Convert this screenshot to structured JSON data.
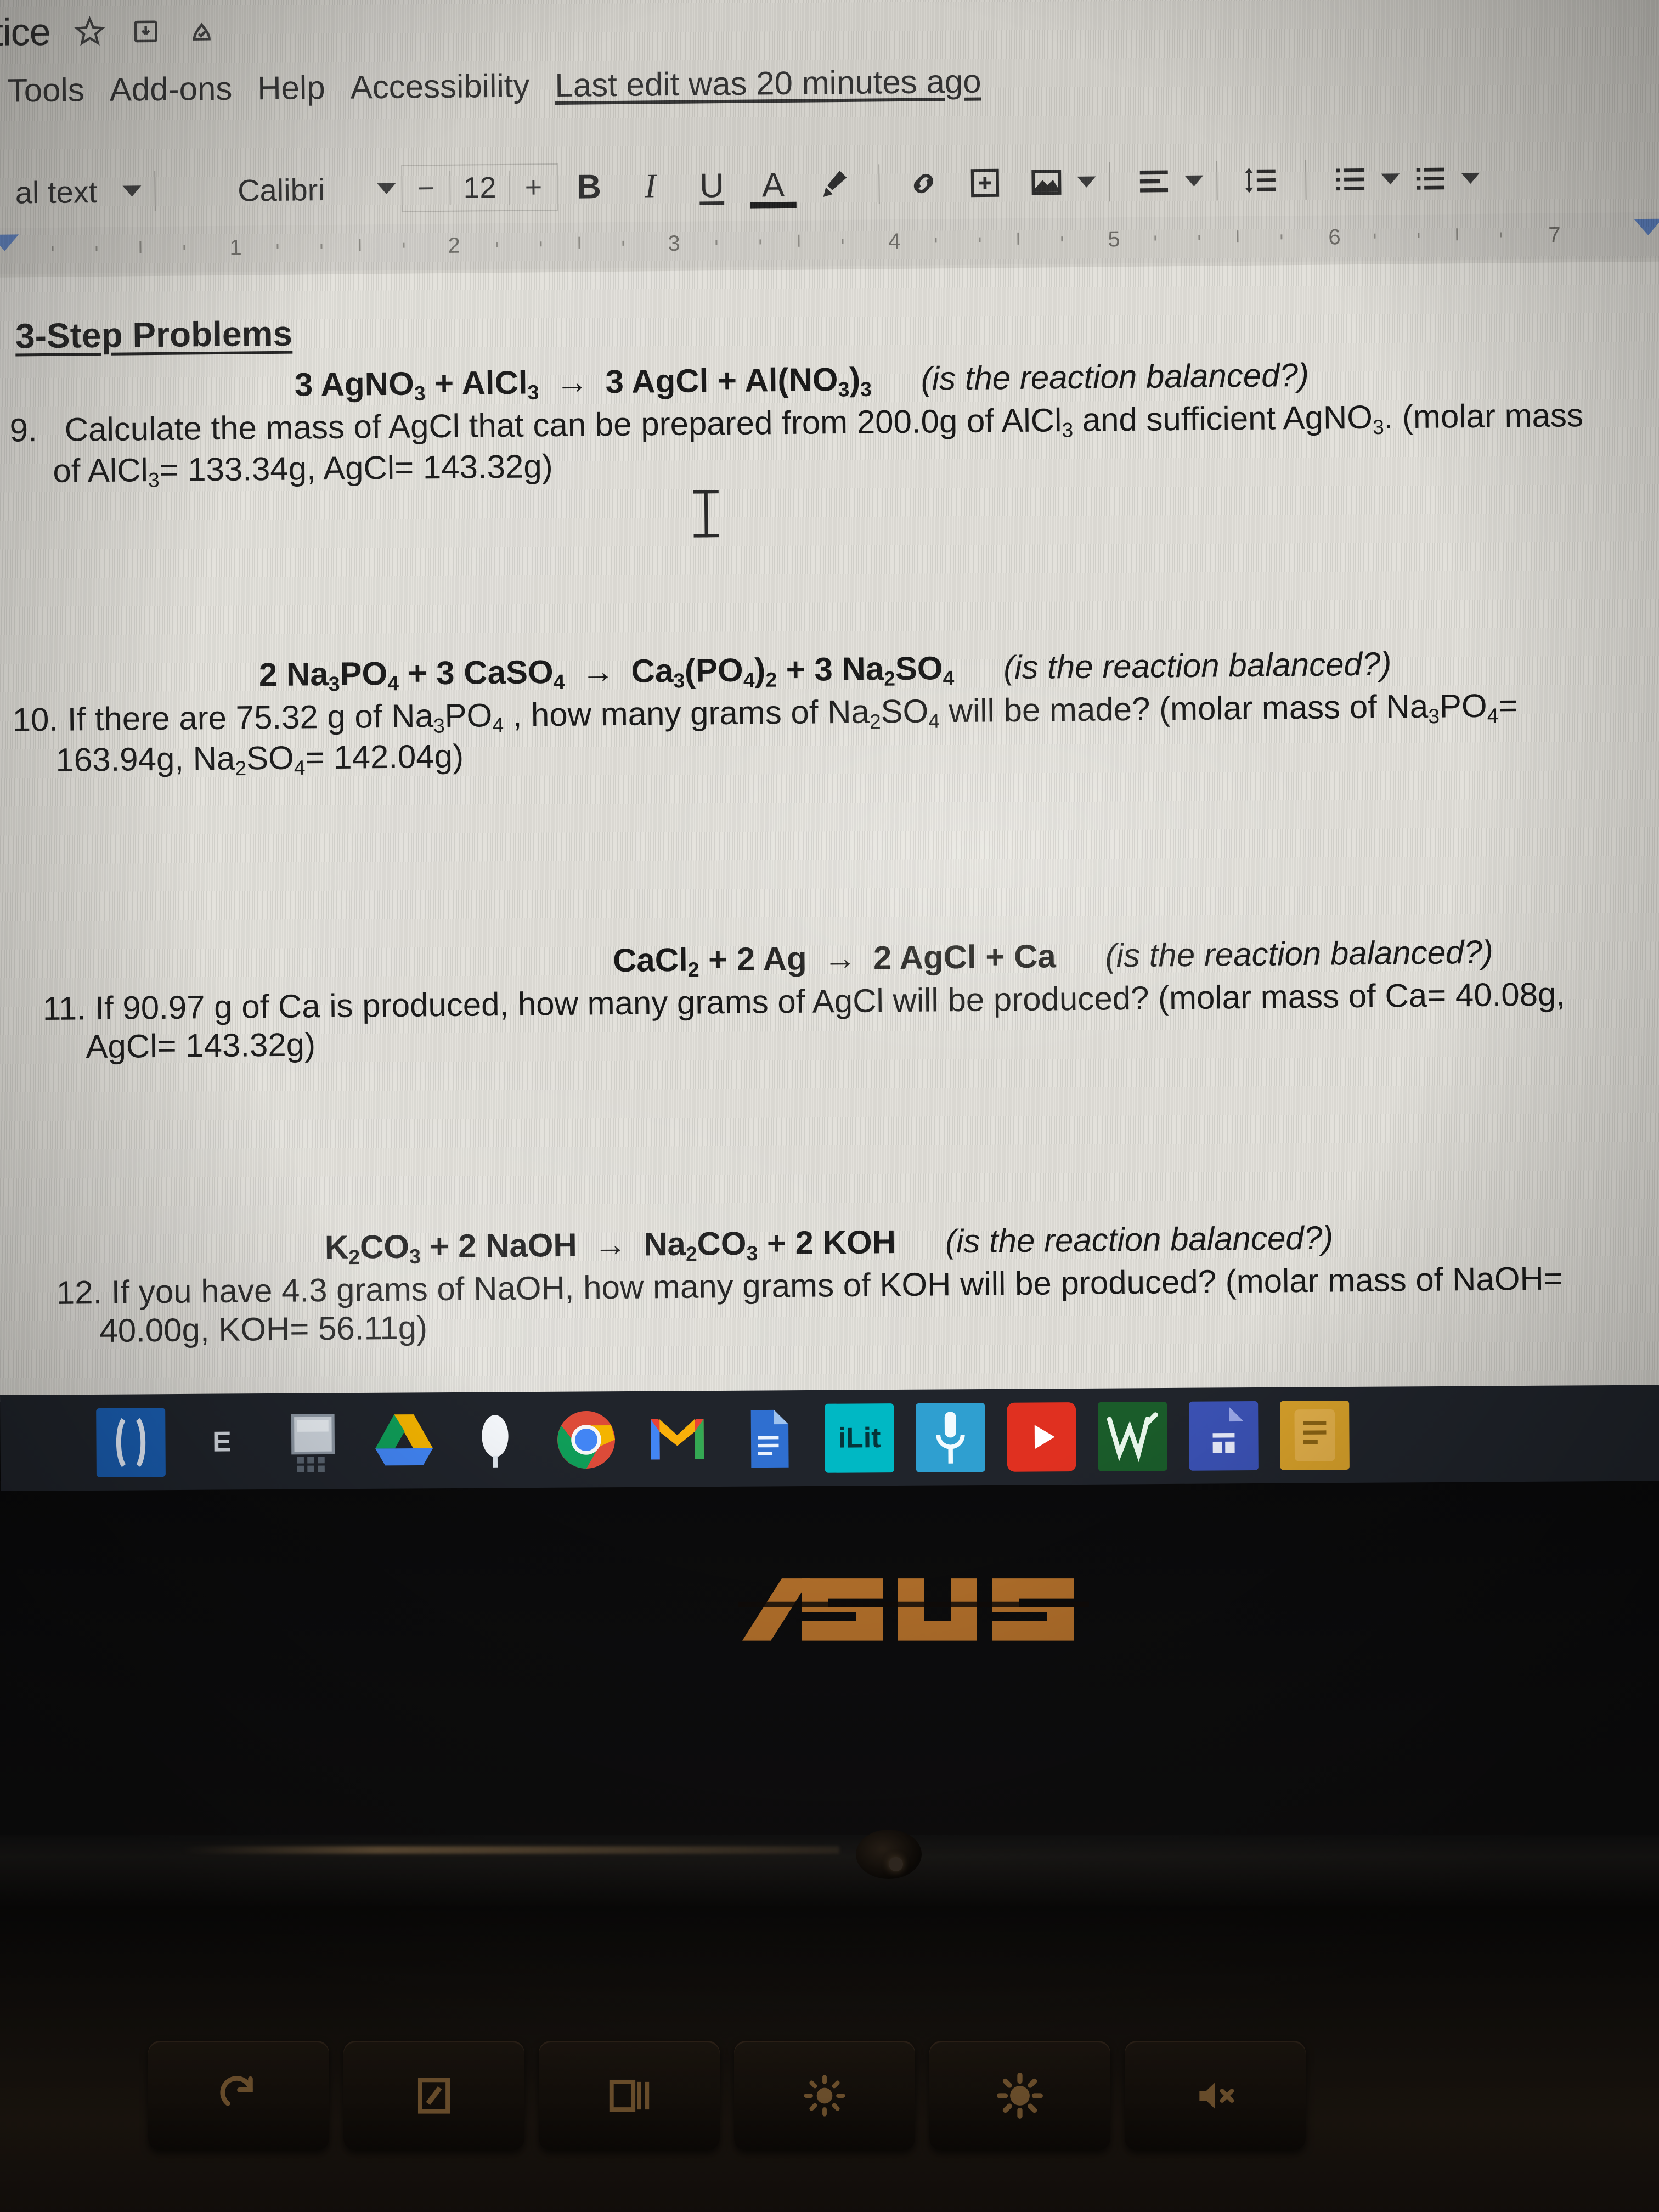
{
  "app": {
    "name": "Google Docs",
    "doc_title": "ctice",
    "title_icons": [
      "star-icon",
      "move-to-folder-icon",
      "cloud-saved-icon"
    ]
  },
  "menubar": {
    "items": [
      "Tools",
      "Add-ons",
      "Help",
      "Accessibility"
    ],
    "last_edit": "Last edit was 20 minutes ago"
  },
  "toolbar": {
    "paragraph_style": "al text",
    "font_family": "Calibri",
    "font_size": "12",
    "decrease_label": "−",
    "increase_label": "+",
    "bold_label": "B",
    "italic_label": "I",
    "underline_label": "U",
    "text_color_label": "A",
    "icons": [
      "highlight-pen-icon",
      "insert-link-icon",
      "add-comment-icon",
      "insert-image-icon",
      "align-icon",
      "line-spacing-icon",
      "numbered-list-icon",
      "bulleted-list-icon"
    ]
  },
  "ruler": {
    "numbers": [
      "1",
      "2",
      "3",
      "4",
      "5",
      "6",
      "7"
    ]
  },
  "document": {
    "heading": "3-Step Problems",
    "balanced_note": "(is the reaction balanced?)",
    "problems": [
      {
        "number": "9.",
        "equation_html": "3 AgNO<sub>3</sub> + AlCl<sub>3</sub> <span class=\"arrow\">→</span> 3 AgCl + Al(NO<sub>3</sub>)<sub>3</sub>",
        "text_html": "Calculate the mass of AgCl that can be prepared from 200.0g of AlCl<sub>3</sub> and sufficient AgNO<sub>3</sub>. (molar mass",
        "text_html2": "of AlCl<sub>3</sub>= 133.34g, AgCl= 143.32g)"
      },
      {
        "number": "10.",
        "equation_html": "2 Na<sub>3</sub>PO<sub>4</sub> + 3 CaSO<sub>4</sub> <span class=\"arrow\">→</span> Ca<sub>3</sub>(PO<sub>4</sub>)<sub>2</sub> + 3 Na<sub>2</sub>SO<sub>4</sub>",
        "text_html": "If there are 75.32 g of Na<sub>3</sub>PO<sub>4</sub> , how many grams of Na<sub>2</sub>SO<sub>4</sub> will be made? (molar mass of Na<sub>3</sub>PO<sub>4</sub>=",
        "text_html2": "163.94g, Na<sub>2</sub>SO<sub>4</sub>= 142.04g)"
      },
      {
        "number": "11.",
        "equation_html": "CaCl<sub>2</sub> + 2 Ag <span class=\"arrow\">→</span> 2 AgCl + Ca",
        "text_html": "If 90.97 g of Ca is produced, how many grams of AgCl will be produced? (molar mass of Ca= 40.08g,",
        "text_html2": "AgCl= 143.32g)"
      },
      {
        "number": "12.",
        "equation_html": "K<sub>2</sub>CO<sub>3</sub> + 2 NaOH <span class=\"arrow\">→</span> Na<sub>2</sub>CO<sub>3</sub> + 2 KOH",
        "text_html": "If you have 4.3 grams of NaOH, how many grams of KOH will be produced? (molar mass of NaOH=",
        "text_html2": "40.00g, KOH= 56.11g)"
      }
    ]
  },
  "shelf": {
    "apps": [
      {
        "name": "launcher-icon",
        "label": "",
        "color": "#1a5fb4"
      },
      {
        "name": "edge-browser-icon",
        "label": "E",
        "color": "#2a2f38"
      },
      {
        "name": "calculator-icon",
        "label": "",
        "color": "#2a2f38"
      },
      {
        "name": "google-drive-icon",
        "label": "",
        "color": "#2a2f38"
      },
      {
        "name": "cloud-app-icon",
        "label": "",
        "color": "#2a2f38"
      },
      {
        "name": "chrome-browser-icon",
        "label": "",
        "color": "#2a2f38"
      },
      {
        "name": "gmail-icon",
        "label": "",
        "color": "#2a2f38"
      },
      {
        "name": "google-docs-icon",
        "label": "",
        "color": "#2a2f38"
      },
      {
        "name": "ilit-app-icon",
        "label": "iLit",
        "color": "#00b8c4"
      },
      {
        "name": "microphone-app-icon",
        "label": "",
        "color": "#2f9fd0"
      },
      {
        "name": "youtube-icon",
        "label": "",
        "color": "#e03020"
      },
      {
        "name": "signature-app-icon",
        "label": "",
        "color": "#1a5c2a"
      },
      {
        "name": "spreadsheet-app-icon",
        "label": "",
        "color": "#3b52b5"
      },
      {
        "name": "notes-app-icon",
        "label": "",
        "color": "#d8a12a"
      }
    ]
  },
  "laptop": {
    "brand": "ASUS",
    "keys": [
      "reload-key",
      "fullscreen-key",
      "window-overview-key",
      "brightness-down-key",
      "brightness-up-key",
      "mute-key"
    ]
  },
  "colors": {
    "screen_bg": "#d3d1cb",
    "page_bg": "#e2e0da",
    "text": "#151515",
    "shelf_bg": "#20242b",
    "asus_orange": "#c0782e",
    "ruler_blue": "#5b7fbf"
  }
}
